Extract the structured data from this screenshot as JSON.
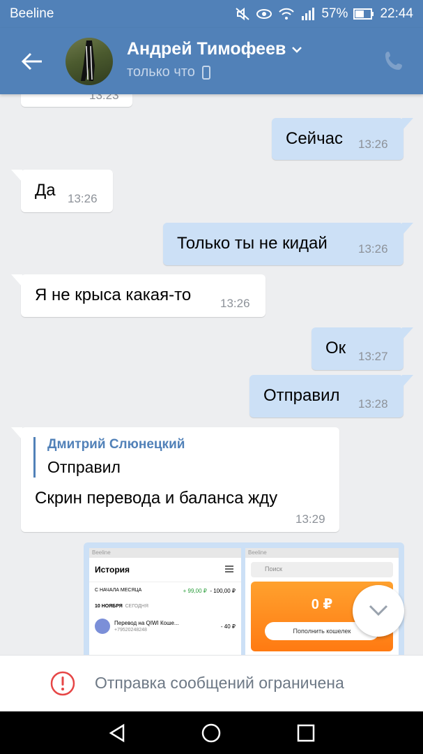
{
  "status_bar": {
    "carrier": "Beeline",
    "battery": "57%",
    "time": "22:44"
  },
  "header": {
    "name": "Андрей Тимофеев",
    "status": "только что"
  },
  "messages": [
    {
      "dir": "in",
      "text": "",
      "time": "13:23"
    },
    {
      "dir": "out",
      "text": "Сейчас",
      "time": "13:26"
    },
    {
      "dir": "in",
      "text": "Да",
      "time": "13:26"
    },
    {
      "dir": "out",
      "text": "Только ты не кидай",
      "time": "13:26"
    },
    {
      "dir": "in",
      "text": "Я не крыса какая-то",
      "time": "13:26"
    },
    {
      "dir": "out",
      "text": "Ок",
      "time": "13:27"
    },
    {
      "dir": "out",
      "text": "Отправил",
      "time": "13:28"
    },
    {
      "dir": "in",
      "quote_author": "Дмитрий Слюнецкий",
      "quote_text": "Отправил",
      "text": "Скрин перевода и баланса жду",
      "time": "13:29"
    }
  ],
  "screenshot_attachment": {
    "left_panel": {
      "carrier": "Beeline",
      "title": "История",
      "period": "С НАЧАЛА МЕСЯЦА",
      "income": "+ 99,00 ₽",
      "expense": "- 100,00 ₽",
      "date": "10 НОЯБРЯ",
      "date_sub": "СЕГОДНЯ",
      "tx_title": "Перевод на QIWI Коше...",
      "tx_amount": "- 40 ₽",
      "tx_phone": "+79520248248"
    },
    "right_panel": {
      "carrier": "Beeline",
      "search_placeholder": "Поиск",
      "balance": "0 ₽",
      "topup_button": "Пополнить кошелек"
    }
  },
  "restriction": {
    "text": "Отправка сообщений ограничена"
  },
  "colors": {
    "vk_blue": "#5181b8",
    "outgoing_bubble": "#cce0f6",
    "chat_bg": "#edeef0",
    "alert_red": "#e64646"
  }
}
